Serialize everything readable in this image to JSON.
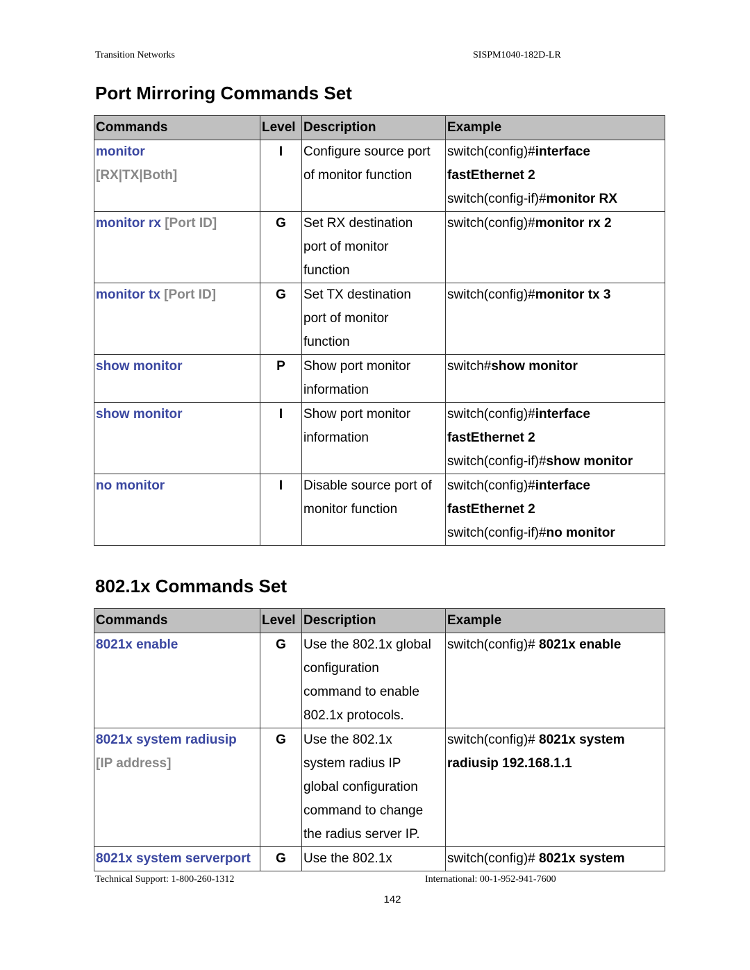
{
  "header": {
    "company": "Transition Networks",
    "model": "SISPM1040-182D-LR"
  },
  "sections": [
    {
      "title": "Port Mirroring Commands Set",
      "columns": [
        "Commands",
        "Level",
        "Description",
        "Example"
      ],
      "rows": [
        {
          "command": "monitor",
          "param": "[RX|TX|Both]",
          "level": "I",
          "description": [
            "Configure source port",
            "of monitor function"
          ],
          "example": [
            {
              "plain": "switch(config)#",
              "bold": "interface"
            },
            {
              "plain": "",
              "bold": "fastEthernet 2"
            },
            {
              "plain": "switch(config-if)#",
              "bold": "monitor RX"
            }
          ]
        },
        {
          "command": "monitor rx",
          "param": "[Port ID]",
          "level": "G",
          "description": [
            "Set RX destination",
            "port of monitor",
            "function"
          ],
          "example": [
            {
              "plain": "switch(config)#",
              "bold": "monitor rx 2"
            }
          ]
        },
        {
          "command": "monitor tx",
          "param": "[Port ID]",
          "level": "G",
          "description": [
            "Set TX destination",
            "port of monitor",
            "function"
          ],
          "example": [
            {
              "plain": "switch(config)#",
              "bold": "monitor tx 3"
            }
          ]
        },
        {
          "command": "show monitor",
          "param": "",
          "level": "P",
          "description": [
            "Show port monitor",
            "information"
          ],
          "example": [
            {
              "plain": "switch#",
              "bold": "show monitor"
            }
          ]
        },
        {
          "command": "show monitor",
          "param": "",
          "level": "I",
          "description": [
            "Show port monitor",
            "information"
          ],
          "example": [
            {
              "plain": "switch(config)#",
              "bold": "interface"
            },
            {
              "plain": "",
              "bold": "fastEthernet 2"
            },
            {
              "plain": "switch(config-if)#",
              "bold": "show monitor"
            }
          ]
        },
        {
          "command": "no monitor",
          "param": "",
          "level": "I",
          "description": [
            "Disable source port of",
            "monitor function"
          ],
          "example": [
            {
              "plain": "switch(config)#",
              "bold": "interface"
            },
            {
              "plain": "",
              "bold": "fastEthernet 2"
            },
            {
              "plain": "switch(config-if)#",
              "bold": "no monitor"
            }
          ]
        }
      ]
    },
    {
      "title": "802.1x Commands Set",
      "columns": [
        "Commands",
        "Level",
        "Description",
        "Example"
      ],
      "rows": [
        {
          "command": "8021x enable",
          "param": "",
          "level": "G",
          "description": [
            "Use the 802.1x global",
            "configuration",
            "command to enable",
            "802.1x protocols."
          ],
          "example": [
            {
              "plain": "switch(config)# ",
              "bold": "8021x enable"
            }
          ]
        },
        {
          "command": "8021x system radiusip",
          "param": "[IP address]",
          "level": "G",
          "description": [
            "Use the 802.1x",
            "system radius IP",
            "global configuration",
            "command to change",
            "the radius server IP."
          ],
          "example": [
            {
              "plain": "switch(config)# ",
              "bold": "8021x system"
            },
            {
              "plain": "",
              "bold": "radiusip 192.168.1.1"
            }
          ]
        },
        {
          "command": "8021x system serverport",
          "param": "",
          "level": "G",
          "description": [
            "Use the 802.1x"
          ],
          "example": [
            {
              "plain": "switch(config)# ",
              "bold": "8021x system"
            }
          ]
        }
      ]
    }
  ],
  "footer": {
    "support": "Technical Support: 1-800-260-1312",
    "international": "International: 00-1-952-941-7600",
    "page_number": "142"
  },
  "colors": {
    "header_bg": "#c0c0c0",
    "command_text": "#3a47a0",
    "param_text": "#888888"
  }
}
